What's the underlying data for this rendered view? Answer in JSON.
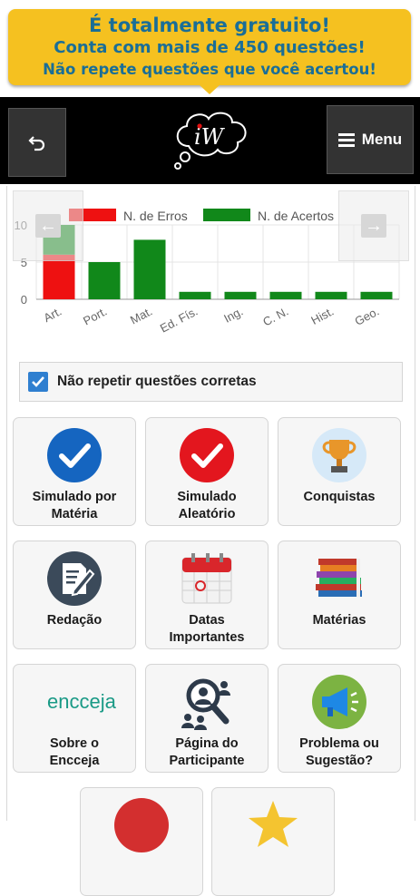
{
  "banner": {
    "line1": "É totalmente gratuito!",
    "line2": "Conta com mais de 450 questões!",
    "line3": "Não repete questões que você acertou!"
  },
  "header": {
    "back_icon": "undo-arrow-icon",
    "logo_text": "iW",
    "menu_label": "Menu"
  },
  "chart_data": {
    "type": "bar",
    "categories": [
      "Art.",
      "Port.",
      "Mat.",
      "Ed. Fís.",
      "Ing.",
      "C. N.",
      "Hist.",
      "Geo."
    ],
    "series": [
      {
        "name": "N. de Erros",
        "color": "#ee1111",
        "values": [
          6,
          0,
          0,
          0,
          0,
          0,
          0,
          0
        ]
      },
      {
        "name": "N. de Acertos",
        "color": "#11881a",
        "values": [
          4,
          5,
          8,
          1,
          1,
          1,
          1,
          1
        ]
      }
    ],
    "stacked": true,
    "ylim": [
      0,
      10
    ],
    "yticks": [
      0,
      5,
      10
    ],
    "legend": "top",
    "grid": true
  },
  "options": {
    "no_repeat_label": "Não repetir questões corretas",
    "no_repeat_checked": true
  },
  "tiles": [
    {
      "label1": "Simulado por",
      "label2": "Matéria",
      "icon": "check-circle-blue-icon"
    },
    {
      "label1": "Simulado",
      "label2": "Aleatório",
      "icon": "check-circle-red-icon"
    },
    {
      "label1": "Conquistas",
      "label2": "",
      "icon": "trophy-icon"
    },
    {
      "label1": "Redação",
      "label2": "",
      "icon": "edit-document-icon"
    },
    {
      "label1": "Datas",
      "label2": "Importantes",
      "icon": "calendar-icon"
    },
    {
      "label1": "Matérias",
      "label2": "",
      "icon": "books-icon"
    },
    {
      "label1": "Sobre o",
      "label2": "Encceja",
      "icon": "encceja-logo",
      "logo_text": "encceja"
    },
    {
      "label1": "Página do",
      "label2": "Participante",
      "icon": "participant-search-icon"
    },
    {
      "label1": "Problema ou",
      "label2": "Sugestão?",
      "icon": "megaphone-icon"
    }
  ]
}
